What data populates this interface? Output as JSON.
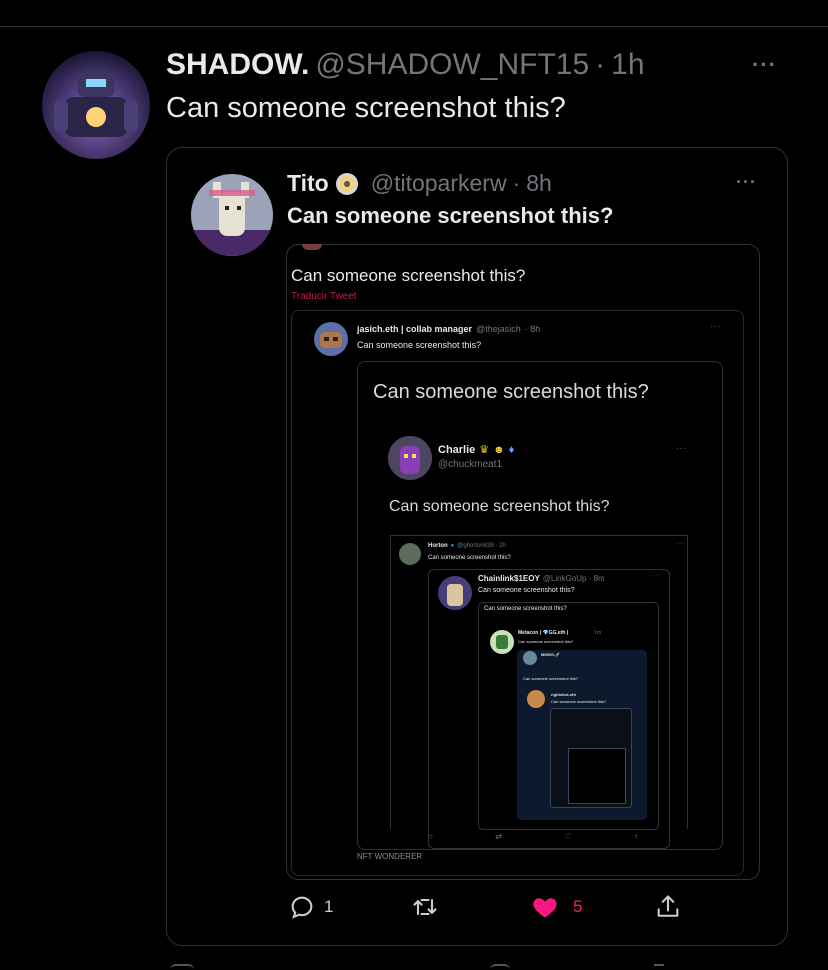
{
  "tweet": {
    "display_name": "SHADOW.",
    "handle": "@SHADOW_NFT15",
    "separator": "·",
    "time": "1h",
    "text": "Can someone screenshot this?",
    "more": "···"
  },
  "quote1": {
    "display_name": "Tito",
    "handle": "@titoparkerw",
    "separator": "·",
    "time": "8h",
    "text": "Can someone screenshot this?",
    "more": "···"
  },
  "shot1": {
    "text": "Can someone screenshot this?",
    "translate": "Traducir Tweet"
  },
  "shot2": {
    "display_name": "jasich.eth | collab manager",
    "handle": "@thejasich",
    "time": "· 8h",
    "text": "Can someone screenshot this?",
    "more": "···"
  },
  "shot3": {
    "heading": "Can someone screenshot this?",
    "display_name": "Charlie",
    "handle": "@chuckmeat1",
    "text": "Can someone screenshot this?",
    "footer": "NFT WONDERER",
    "more": "···"
  },
  "shot4": {
    "display_name": "Horton",
    "handle": "@ghorton639 · 2h",
    "text": "Can someone screenshot this?",
    "more": "···"
  },
  "shot5": {
    "display_name": "Chainlink$1EOY",
    "handle": "@LinkGoUp · 8m",
    "text": "Can someone screenshot this?",
    "text2": "Can someone screenshot this?",
    "more": "···"
  },
  "shot6": {
    "display_name": "Metacon | 💎GG.eth |",
    "time": "· 1m",
    "text": "Can someone screenshot this?",
    "name2": "MIKEG.🚀",
    "text2": "Can someone screenshot this?",
    "name3": "rightclick.eth",
    "text3": "Can someone screenshot this?"
  },
  "actions": {
    "reply_count": "1",
    "retweet_count": "",
    "like_count": "5"
  },
  "colors": {
    "background": "#000000",
    "text": "#e7e9ea",
    "muted": "#71767b",
    "border": "#2f3336",
    "like": "#f91880"
  }
}
